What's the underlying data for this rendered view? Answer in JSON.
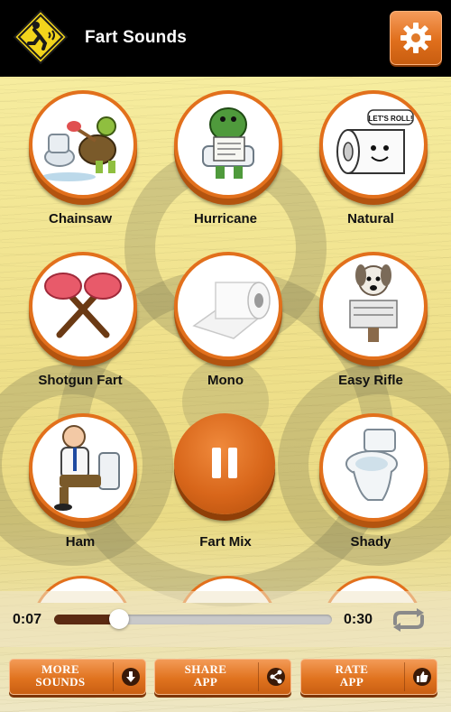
{
  "header": {
    "title": "Fart Sounds",
    "logo_icon": "farting-man-warning-sign-icon",
    "settings_icon": "gear-icon"
  },
  "sounds": [
    {
      "label": "Chainsaw",
      "icon": "turtle-with-toilet-plunger-icon"
    },
    {
      "label": "Hurricane",
      "icon": "dinosaur-reading-on-toilet-icon"
    },
    {
      "label": "Natural",
      "icon": "toilet-paper-lets-roll-icon"
    },
    {
      "label": "Shotgun Fart",
      "icon": "crossed-plungers-icon"
    },
    {
      "label": "Mono",
      "icon": "toilet-paper-roll-icon"
    },
    {
      "label": "Easy Rifle",
      "icon": "dog-reading-newspaper-icon"
    },
    {
      "label": "Ham",
      "icon": "man-sitting-on-toilet-icon"
    },
    {
      "label": "Fart Mix",
      "icon": "pause-icon"
    },
    {
      "label": "Shady",
      "icon": "toilet-icon"
    }
  ],
  "comic_bubble": "LET'S ROLL!",
  "player": {
    "current_time": "0:07",
    "total_time": "0:30",
    "progress": 0.2333,
    "repeat_icon": "repeat-icon"
  },
  "bottom_bar": {
    "more_sounds": "MORE SOUNDS",
    "share_app": "SHARE APP",
    "rate_app": "RATE APP",
    "icons": [
      "download-icon",
      "share-icon",
      "thumbs-up-icon"
    ]
  },
  "colors": {
    "accent": "#e2701c",
    "header_bg": "#000000",
    "background": "#f3e69a"
  }
}
